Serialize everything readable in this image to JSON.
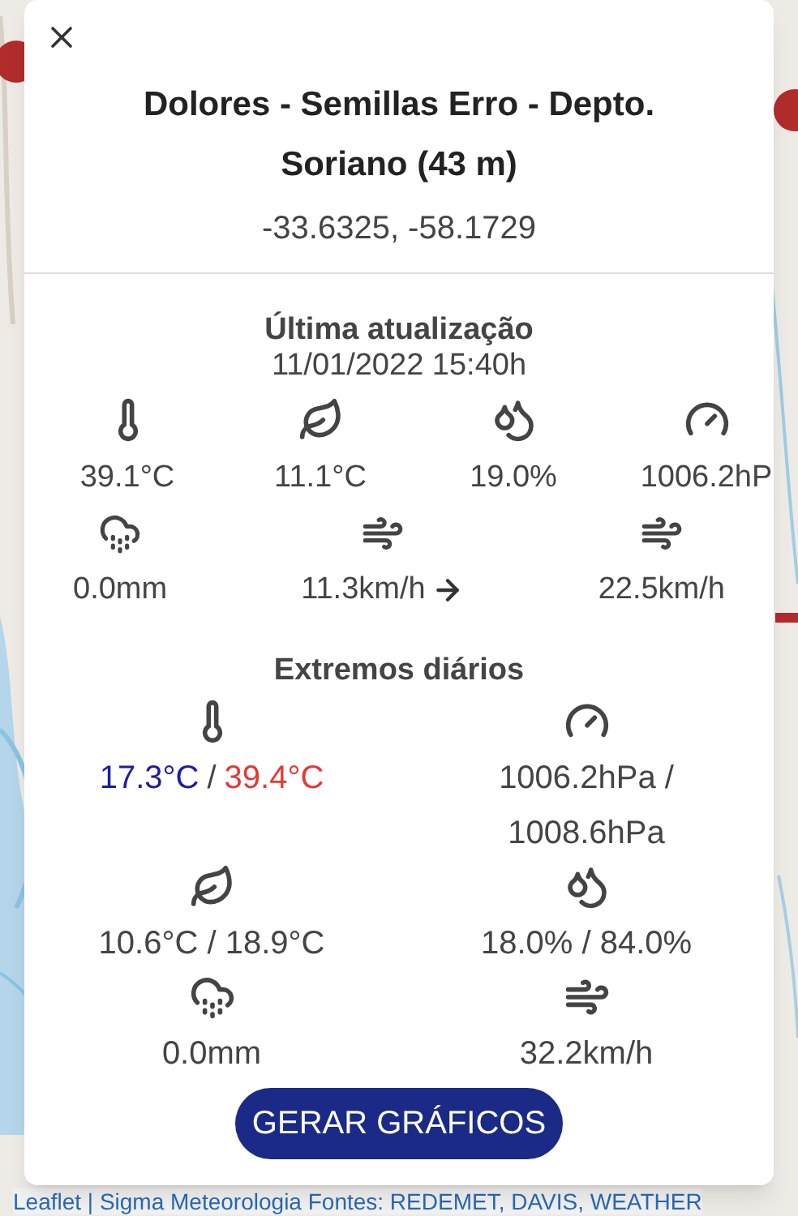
{
  "map": {
    "kind": "picture",
    "attribution": "Leaflet | Sigma Meteorologia Fontes: REDEMET, DAVIS, WEATHER"
  },
  "popup": {
    "title": "Dolores - Semillas Erro - Depto. Soriano (43 m)",
    "coordinates": "-33.6325, -58.1729",
    "current": {
      "heading": "Última atualização",
      "timestamp": "11/01/2022 15:40h",
      "row_1": [
        {
          "kind": "temperature",
          "value": "39.1°C"
        },
        {
          "kind": "dew-point",
          "value": "11.1°C"
        },
        {
          "kind": "humidity",
          "value": "19.0%"
        },
        {
          "kind": "pressure",
          "value": "1006.2hP"
        }
      ],
      "row_2": [
        {
          "kind": "rain",
          "value": "0.0mm",
          "direction_arrow": false
        },
        {
          "kind": "wind",
          "value": "11.3km/h",
          "direction_arrow": true
        },
        {
          "kind": "gust",
          "value": "22.5km/h",
          "direction_arrow": false
        }
      ]
    },
    "extremes": {
      "heading": "Extremos diários",
      "items": [
        {
          "kind": "temperature",
          "parts": [
            {
              "text": "17.3°C",
              "color": "#1c1ca8"
            },
            {
              "text": "/",
              "color": "#444444"
            },
            {
              "text": "39.4°C",
              "color": "#e53935"
            }
          ]
        },
        {
          "kind": "pressure",
          "value": "1006.2hPa / 1008.6hPa"
        },
        {
          "kind": "dew-point",
          "value": "10.6°C / 18.9°C"
        },
        {
          "kind": "humidity",
          "value": "18.0% / 84.0%"
        },
        {
          "kind": "rain",
          "value": "0.0mm"
        },
        {
          "kind": "gust",
          "value": "32.2km/h"
        }
      ]
    },
    "button": "GERAR GRÁFICOS"
  }
}
